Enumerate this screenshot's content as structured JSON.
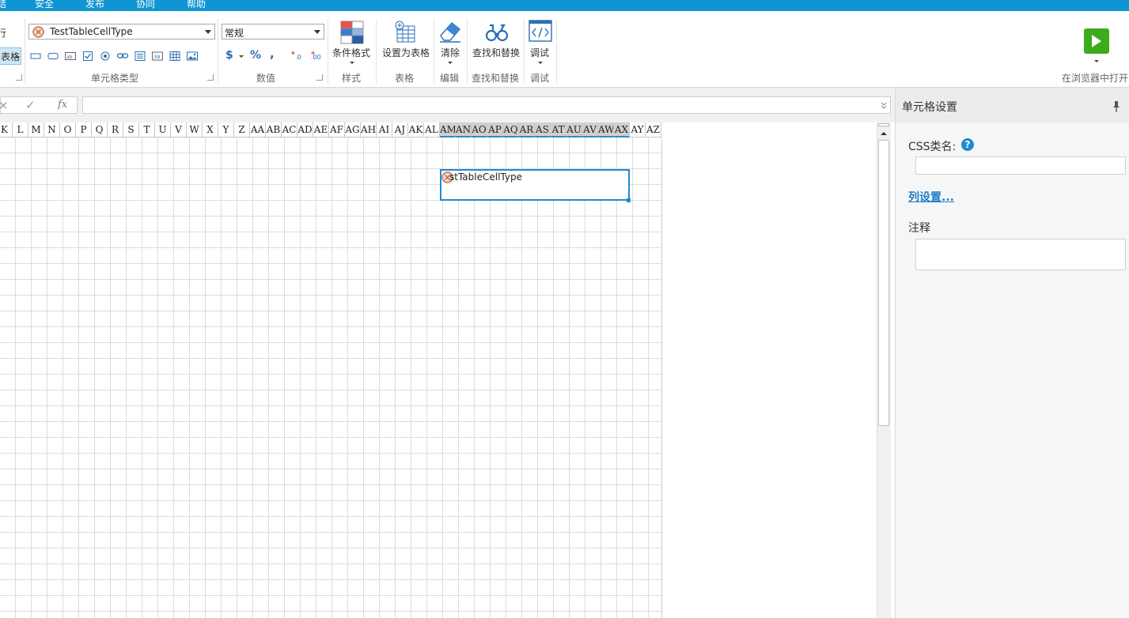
{
  "menu": [
    "结",
    "安全",
    "发布",
    "协同",
    "帮助"
  ],
  "ribbon": {
    "left_partial_1": "行",
    "left_partial_2": "表格",
    "celltype_combo": "TestTableCellType",
    "group_celltype_label": "单元格类型",
    "number_format_combo": "常规",
    "currency_symbol": "$",
    "percent_symbol": "%",
    "comma_symbol": ",",
    "group_number_label": "数值",
    "cond_format_label": "条件格式",
    "group_style_label": "样式",
    "set_table_label": "设置为表格",
    "group_table_label": "表格",
    "clear_label": "清除",
    "group_edit_label": "编辑",
    "find_replace_label": "查找和替换",
    "group_find_label": "查找和替换",
    "debug_label": "调试",
    "group_debug_label": "调试",
    "run_label": "在浏览器中打开"
  },
  "formula": {
    "cancel_icon": "×",
    "confirm_icon": "✓",
    "fx": "fx",
    "value": ""
  },
  "grid": {
    "columns": [
      "K",
      "L",
      "M",
      "N",
      "O",
      "P",
      "Q",
      "R",
      "S",
      "T",
      "U",
      "V",
      "W",
      "X",
      "Y",
      "Z",
      "AA",
      "AB",
      "AC",
      "AD",
      "AE",
      "AF",
      "AG",
      "AH",
      "AI",
      "AJ",
      "AK",
      "AL",
      "AM",
      "AN",
      "AO",
      "AP",
      "AQ",
      "AR",
      "AS",
      "AT",
      "AU",
      "AV",
      "AW",
      "AX",
      "AY",
      "AZ"
    ],
    "selected_range": [
      "AM",
      "AX"
    ],
    "selected_cell_text": "stTableCellType"
  },
  "panel": {
    "title": "单元格设置",
    "css_label": "CSS类名:",
    "css_value": "",
    "column_settings_link": "列设置...",
    "note_label": "注释",
    "note_value": ""
  },
  "colors": {
    "accent": "#0e95d4",
    "selection": "#1f8bd1",
    "run_green": "#3cab1c"
  }
}
